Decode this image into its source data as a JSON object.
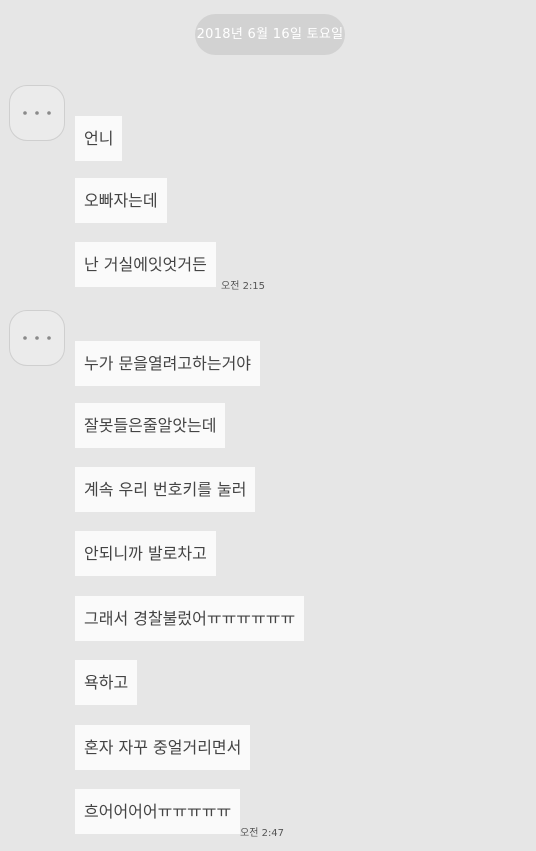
{
  "date_divider": "2018년 6월 16일 토요일",
  "groups": [
    {
      "avatar_icon": "more-dots-icon",
      "messages": [
        "언니",
        "오빠자는데",
        "난 거실에잇엇거든"
      ],
      "time": "오전 2:15"
    },
    {
      "avatar_icon": "more-dots-icon",
      "messages": [
        "누가 문을열려고하는거야",
        "잘못들은줄알앗는데",
        "계속 우리 번호키를 눌러",
        "안되니까 발로차고",
        "그래서 경찰불렀어ㅠㅠㅠㅠㅠㅠ",
        "욕하고",
        "혼자 자꾸 중얼거리면서",
        "흐어어어어ㅠㅠㅠㅠㅠ"
      ],
      "time": "오전 2:47"
    }
  ],
  "colors": {
    "background": "#e6e6e6",
    "bubble": "#fafafa",
    "date_pill": "#d2d2d2"
  }
}
